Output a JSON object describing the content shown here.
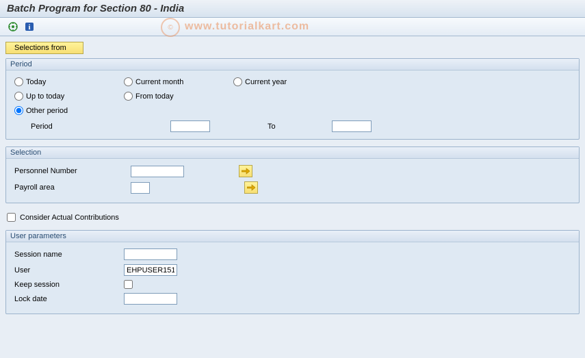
{
  "title": "Batch Program for Section 80 - India",
  "watermark": "www.tutorialkart.com",
  "toolbar": {
    "execute_icon": "execute-icon",
    "info_icon": "info-icon"
  },
  "selections_from_label": "Selections from",
  "period": {
    "title": "Period",
    "today": "Today",
    "up_to_today": "Up to today",
    "other_period": "Other period",
    "current_month": "Current month",
    "from_today": "From today",
    "current_year": "Current year",
    "period_label": "Period",
    "to_label": "To",
    "period_from_value": "",
    "period_to_value": "",
    "selected": "other_period"
  },
  "selection": {
    "title": "Selection",
    "personnel_number_label": "Personnel Number",
    "personnel_number_value": "",
    "payroll_area_label": "Payroll area",
    "payroll_area_value": ""
  },
  "consider_label": "Consider Actual Contributions",
  "consider_checked": false,
  "user_params": {
    "title": "User parameters",
    "session_name_label": "Session name",
    "session_name_value": "",
    "user_label": "User",
    "user_value": "EHPUSER151",
    "keep_session_label": "Keep session",
    "keep_session_checked": false,
    "lock_date_label": "Lock date",
    "lock_date_value": ""
  }
}
